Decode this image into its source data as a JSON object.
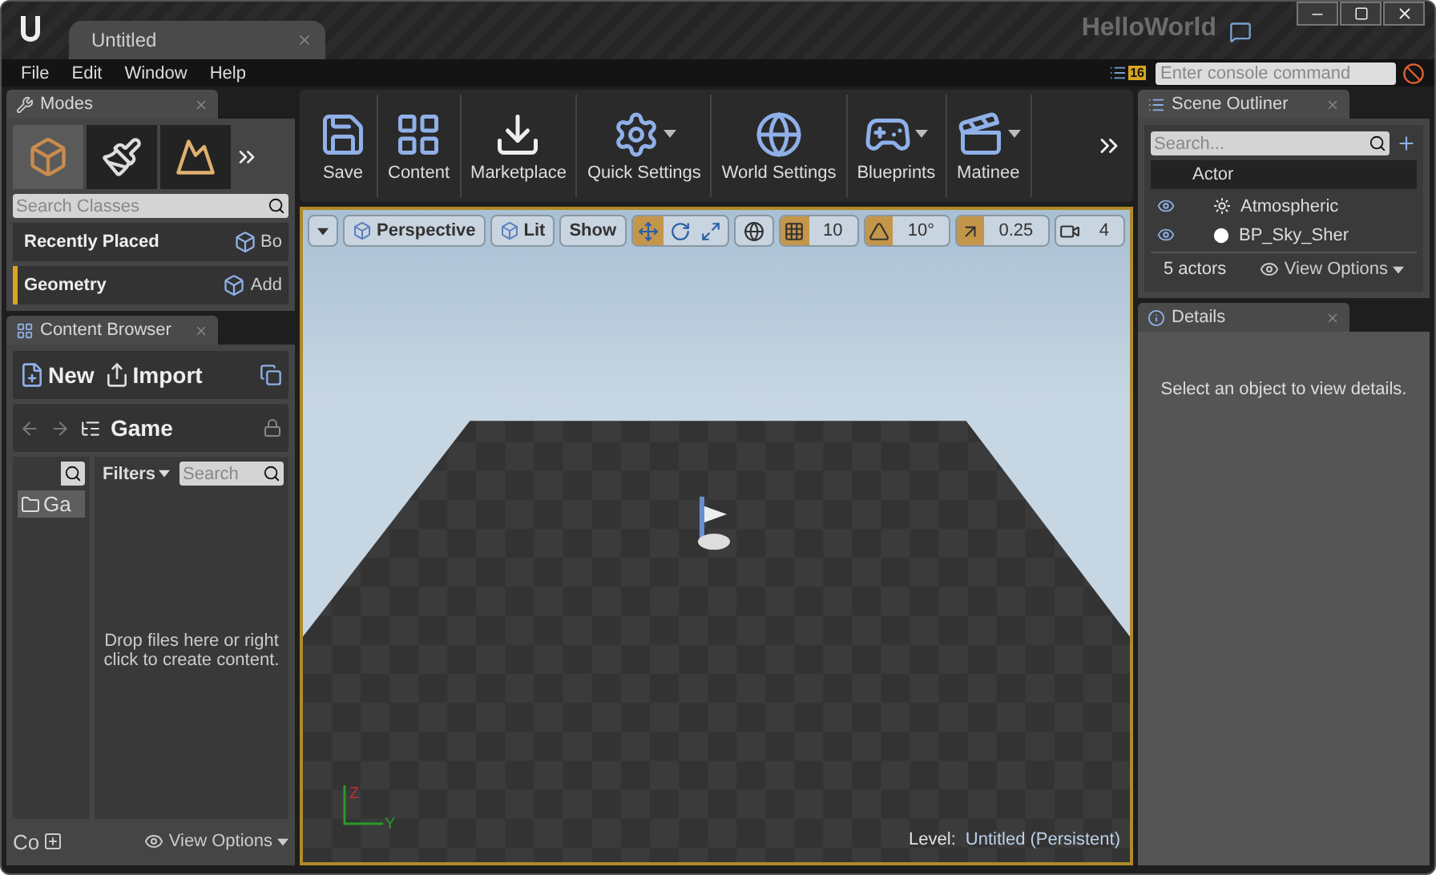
{
  "window": {
    "tab": "Untitled",
    "project": "HelloWorld"
  },
  "menu": [
    "File",
    "Edit",
    "Window",
    "Help"
  ],
  "notifications": {
    "count": "16"
  },
  "console": {
    "placeholder": "Enter console command"
  },
  "modes": {
    "tab": "Modes",
    "mode_tabs": [
      {
        "kind": "place",
        "selected": true
      },
      {
        "kind": "paint",
        "selected": false
      },
      {
        "kind": "landscape",
        "selected": false
      }
    ],
    "search": {
      "placeholder": "Search Classes"
    },
    "categories": [
      {
        "label": "Recently Placed",
        "selected": false,
        "item": "Bo"
      },
      {
        "label": "Geometry",
        "selected": true,
        "item": "Add"
      }
    ]
  },
  "content_browser": {
    "tab": "Content Browser",
    "new": "New",
    "import": "Import",
    "path": "Game",
    "tree": [
      "Ga"
    ],
    "filters": "Filters",
    "search": {
      "placeholder": "Search"
    },
    "empty_text": "Drop files here or right click to create content.",
    "collections": "Co",
    "view_options": "View Options"
  },
  "toolbar": [
    {
      "label": "Save",
      "kind": "save",
      "dropdown": false
    },
    {
      "label": "Content",
      "kind": "content",
      "dropdown": false
    },
    {
      "label": "Marketplace",
      "kind": "marketplace",
      "dropdown": false
    },
    {
      "label": "Quick Settings",
      "kind": "settings",
      "dropdown": true
    },
    {
      "label": "World Settings",
      "kind": "world",
      "dropdown": false
    },
    {
      "label": "Blueprints",
      "kind": "blueprints",
      "dropdown": true
    },
    {
      "label": "Matinee",
      "kind": "matinee",
      "dropdown": true
    }
  ],
  "viewport": {
    "view": "Perspective",
    "lighting": "Lit",
    "show": "Show",
    "transform_tools": [
      {
        "kind": "move",
        "selected": true
      },
      {
        "kind": "rotate",
        "selected": false
      },
      {
        "kind": "scale",
        "selected": false
      }
    ],
    "snaps": [
      {
        "kind": "grid",
        "value": "10",
        "on": true
      },
      {
        "kind": "angle",
        "value": "10°",
        "on": true
      },
      {
        "kind": "scale",
        "value": "0.25",
        "on": true
      },
      {
        "kind": "camera",
        "value": "4",
        "on": false
      }
    ],
    "axes": [
      "Z",
      "Y"
    ],
    "level_label": "Level:",
    "level": "Untitled (Persistent)"
  },
  "scene_outliner": {
    "tab": "Scene Outliner",
    "search": {
      "placeholder": "Search..."
    },
    "column": "Actor",
    "rows": [
      {
        "name": "Atmospheric",
        "kind": "light"
      },
      {
        "name": "BP_Sky_Sher",
        "kind": "sphere"
      }
    ],
    "count": "5 actors",
    "view_options": "View Options"
  },
  "details": {
    "tab": "Details",
    "message": "Select an object to view details."
  }
}
